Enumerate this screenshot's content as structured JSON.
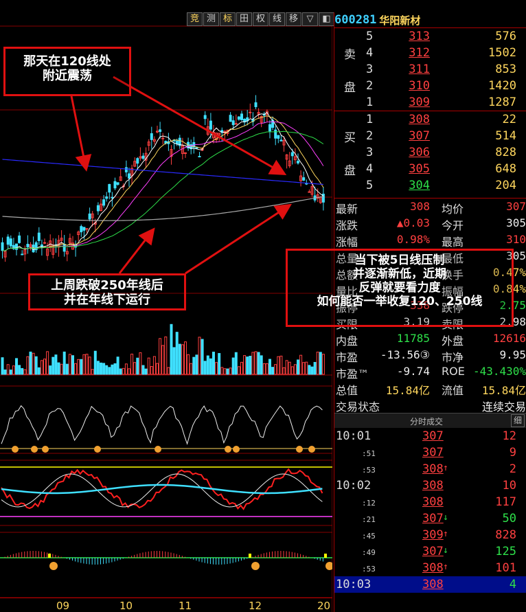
{
  "toolbar": {
    "buttons": [
      {
        "label": "竞",
        "highlight": true
      },
      {
        "label": "测",
        "highlight": false
      },
      {
        "label": "标",
        "highlight": true
      },
      {
        "label": "田",
        "highlight": false
      },
      {
        "label": "权",
        "highlight": false
      },
      {
        "label": "线",
        "highlight": false
      },
      {
        "label": "移",
        "highlight": false
      },
      {
        "label": "▽",
        "highlight": false
      },
      {
        "label": "◧",
        "highlight": false
      }
    ]
  },
  "stock": {
    "code": "600281",
    "name": "华阳新材"
  },
  "order_book": {
    "sell_label_top": "卖",
    "sell_label_bottom": "盘",
    "buy_label_top": "买",
    "buy_label_bottom": "盘",
    "sell": [
      {
        "level": "5",
        "price": "313",
        "volume": "576"
      },
      {
        "level": "4",
        "price": "312",
        "volume": "1502"
      },
      {
        "level": "3",
        "price": "311",
        "volume": "853"
      },
      {
        "level": "2",
        "price": "310",
        "volume": "1420"
      },
      {
        "level": "1",
        "price": "309",
        "volume": "1287"
      }
    ],
    "buy": [
      {
        "level": "1",
        "price": "308",
        "volume": "22"
      },
      {
        "level": "2",
        "price": "307",
        "volume": "514"
      },
      {
        "level": "3",
        "price": "306",
        "volume": "828"
      },
      {
        "level": "4",
        "price": "305",
        "volume": "648"
      },
      {
        "level": "5",
        "price": "304",
        "volume": "204"
      }
    ]
  },
  "stats": [
    {
      "k1": "最新",
      "v1": "308",
      "c1": "red",
      "k2": "均价",
      "v2": "307",
      "c2": "red"
    },
    {
      "k1": "涨跌",
      "v1": "▲0.03",
      "c1": "red",
      "k2": "今开",
      "v2": "305",
      "c2": "white"
    },
    {
      "k1": "涨幅",
      "v1": "0.98%",
      "c1": "red",
      "k2": "最高",
      "v2": "310",
      "c2": "red"
    },
    {
      "k1": "总量",
      "v1": "",
      "c1": "yellow",
      "k2": "最低",
      "v2": "305",
      "c2": "white"
    },
    {
      "k1": "总额",
      "v1": "",
      "c1": "yellow",
      "k2": "换手",
      "v2": "0.47%",
      "c2": "yellow"
    },
    {
      "k1": "量比",
      "v1": "",
      "c1": "yellow",
      "k2": "振幅",
      "v2": "0.84%",
      "c2": "yellow"
    },
    {
      "k1": "振停",
      "v1": "338",
      "c1": "red",
      "k2": "跌停",
      "v2": "2.75",
      "c2": "green"
    },
    {
      "k1": "买限",
      "v1": "3.19",
      "c1": "white",
      "k2": "卖限",
      "v2": "2.98",
      "c2": "white"
    },
    {
      "k1": "内盘",
      "v1": "11785",
      "c1": "green",
      "k2": "外盘",
      "v2": "12616",
      "c2": "red"
    },
    {
      "k1": "市盈",
      "v1": "-13.56③",
      "c1": "white",
      "k2": "市净",
      "v2": "9.95",
      "c2": "white"
    },
    {
      "k1": "市盈™",
      "v1": "-9.74",
      "c1": "white",
      "k2": "ROE",
      "v2": "-43.430%",
      "c2": "green"
    },
    {
      "k1": "总值",
      "v1": "15.84亿",
      "c1": "yellow",
      "k2": "流值",
      "v2": "15.84亿",
      "c2": "yellow"
    },
    {
      "k1": "交易状态",
      "v1": "",
      "c1": "white",
      "k2": "",
      "v2": "连续交易",
      "c2": "white"
    }
  ],
  "ticks": {
    "title": "分时成交",
    "detail_label": "细",
    "rows": [
      {
        "time": "10:01",
        "sub": false,
        "price": "307",
        "pc": "red",
        "arrow": "",
        "vol": "12",
        "vc": "red"
      },
      {
        "time": ":51",
        "sub": true,
        "price": "307",
        "pc": "red",
        "arrow": "",
        "vol": "9",
        "vc": "red"
      },
      {
        "time": ":53",
        "sub": true,
        "price": "308",
        "pc": "red",
        "arrow": "↑",
        "vol": "2",
        "vc": "red"
      },
      {
        "time": "10:02",
        "sub": false,
        "price": "308",
        "pc": "red",
        "arrow": "",
        "vol": "10",
        "vc": "red"
      },
      {
        "time": ":12",
        "sub": true,
        "price": "308",
        "pc": "red",
        "arrow": "",
        "vol": "117",
        "vc": "red"
      },
      {
        "time": ":21",
        "sub": true,
        "price": "307",
        "pc": "red",
        "arrow": "↓",
        "vol": "50",
        "vc": "green"
      },
      {
        "time": ":45",
        "sub": true,
        "price": "309",
        "pc": "red",
        "arrow": "↑",
        "vol": "828",
        "vc": "red"
      },
      {
        "time": ":49",
        "sub": true,
        "price": "307",
        "pc": "red",
        "arrow": "↓",
        "vol": "125",
        "vc": "green"
      },
      {
        "time": ":53",
        "sub": true,
        "price": "308",
        "pc": "red",
        "arrow": "↑",
        "vol": "101",
        "vc": "red"
      },
      {
        "time": "10:03",
        "sub": false,
        "price": "308",
        "pc": "red",
        "arrow": "",
        "vol": "4",
        "vc": "green",
        "selected": true
      }
    ]
  },
  "annotations": {
    "top_left": [
      "那天在120线处",
      "附近震荡"
    ],
    "bottom_left": [
      "上周跌破250年线后",
      "并在年线下运行"
    ],
    "right": [
      "当下被5日线压制",
      "并逐渐新低，近期",
      "反弹就要看力度",
      "如何能否一举收复120、250线"
    ]
  },
  "x_axis": {
    "labels": [
      "09",
      "10",
      "11",
      "12",
      "20"
    ]
  },
  "colors": {
    "up": "#ff4040",
    "down": "#3fe0ff",
    "ma5": "#ffffff",
    "ma10": "#ffd75e",
    "ma20": "#ff40ff",
    "ma60": "#2ee04a",
    "ma120": "#2a2aff",
    "ma250": "#aaaaaa",
    "annotation": "#e01010"
  }
}
